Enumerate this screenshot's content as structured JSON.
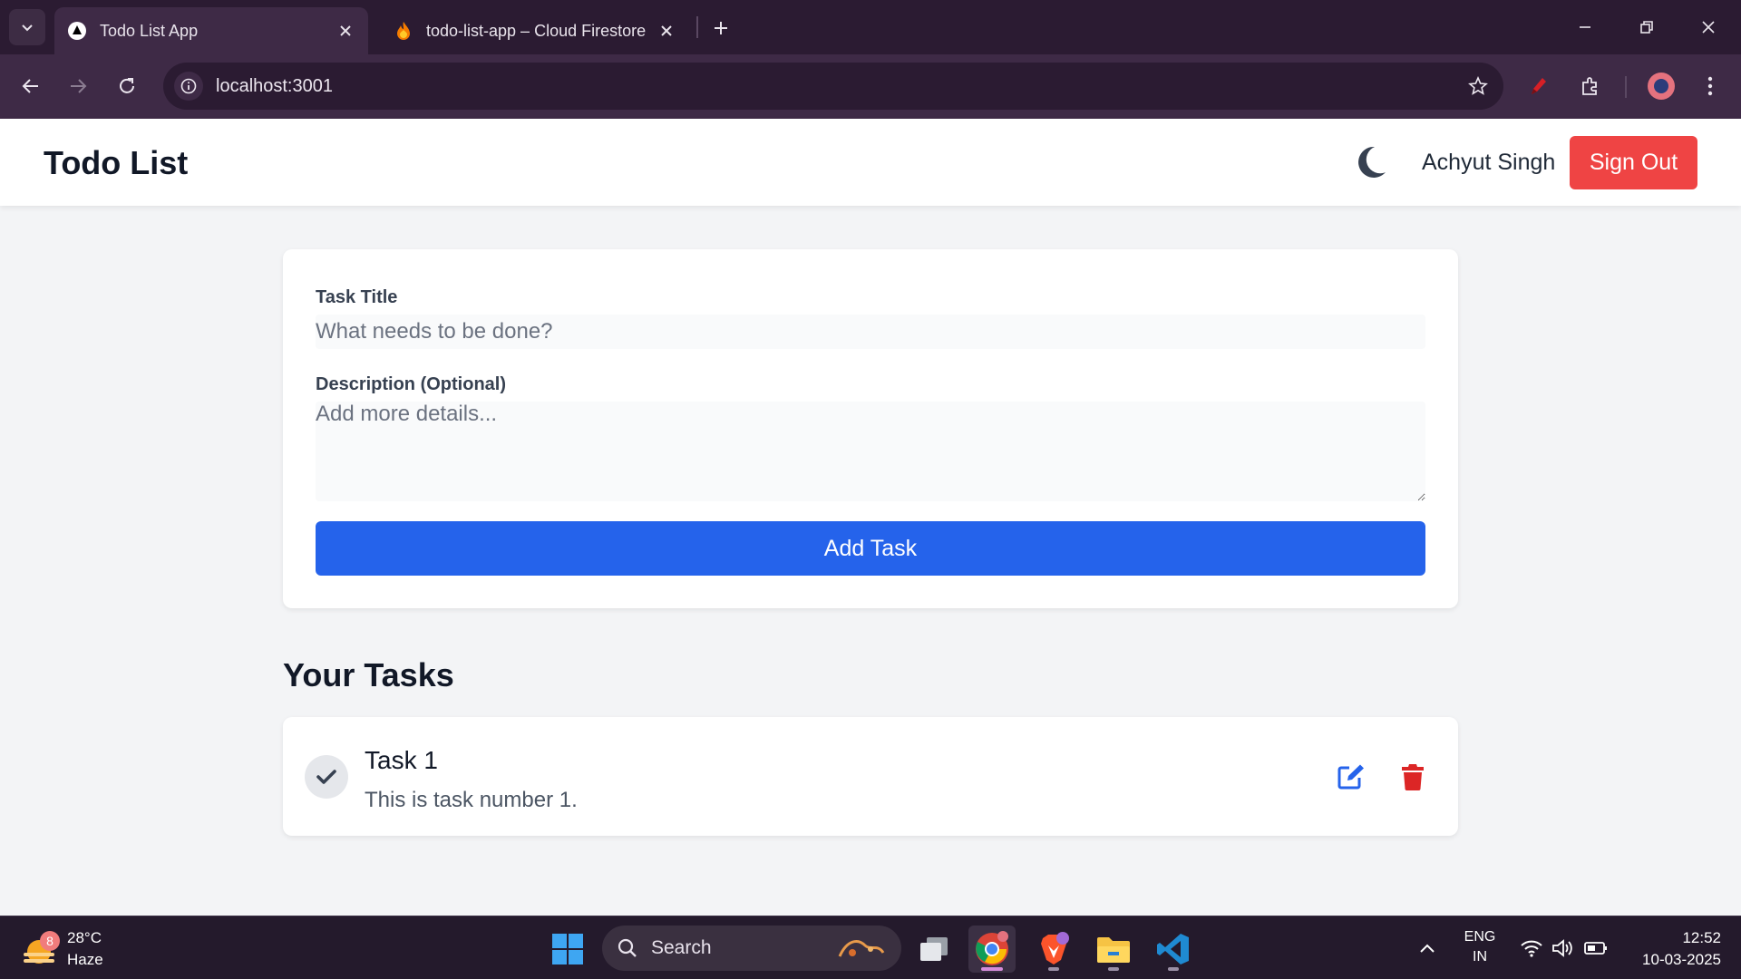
{
  "browser": {
    "tabs": [
      {
        "title": "Todo List App",
        "favicon": "nextjs-icon",
        "active": true
      },
      {
        "title": "todo-list-app – Cloud Firestore",
        "favicon": "firebase-icon",
        "active": false
      }
    ],
    "url": "localhost:3001"
  },
  "header": {
    "title": "Todo List",
    "theme_icon": "moon-icon",
    "user_name": "Achyut Singh",
    "sign_out_label": "Sign Out"
  },
  "form": {
    "title_label": "Task Title",
    "title_placeholder": "What needs to be done?",
    "title_value": "",
    "description_label": "Description (Optional)",
    "description_placeholder": "Add more details...",
    "description_value": "",
    "add_button_label": "Add Task"
  },
  "tasks_section": {
    "title": "Your Tasks",
    "items": [
      {
        "title": "Task 1",
        "description": "This is task number 1."
      }
    ]
  },
  "colors": {
    "primary": "#2563eb",
    "danger": "#ef4444",
    "page_bg": "#f3f4f6",
    "browser_frame": "#3e2a46"
  },
  "taskbar": {
    "weather": {
      "temperature": "28°C",
      "condition": "Haze",
      "badge": "8"
    },
    "search_label": "Search",
    "language": {
      "line1": "ENG",
      "line2": "IN"
    },
    "time": "12:52",
    "date": "10-03-2025"
  }
}
